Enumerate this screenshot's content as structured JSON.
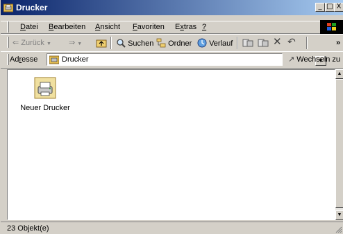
{
  "window": {
    "title": "Drucker",
    "minimize": "_",
    "maximize": "□",
    "close": "X"
  },
  "menu": [
    {
      "label_underlined": "D",
      "label_rest": "atei"
    },
    {
      "label_underlined": "B",
      "label_rest": "earbeiten"
    },
    {
      "label_underlined": "A",
      "label_rest": "nsicht"
    },
    {
      "label_underlined": "F",
      "label_rest": "avoriten"
    },
    {
      "label_pre": "E",
      "label_underlined": "x",
      "label_rest": "tras"
    },
    {
      "label_underlined": "?",
      "label_rest": ""
    }
  ],
  "toolbar": {
    "back_label": "Zurück",
    "forward_label": "",
    "search_label": "Suchen",
    "folders_label": "Ordner",
    "history_label": "Verlauf",
    "overflow": "»"
  },
  "address": {
    "label_pre": "Ad",
    "label_underlined": "r",
    "label_rest": "esse",
    "value": "Drucker",
    "go_label": "Wechseln zu"
  },
  "content": {
    "items": [
      {
        "label": "Neuer Drucker"
      }
    ]
  },
  "status": {
    "text": "23 Objekt(e)"
  },
  "colors": {
    "title_start": "#0a246a",
    "title_end": "#a6caf0",
    "face": "#d4d0c8"
  }
}
